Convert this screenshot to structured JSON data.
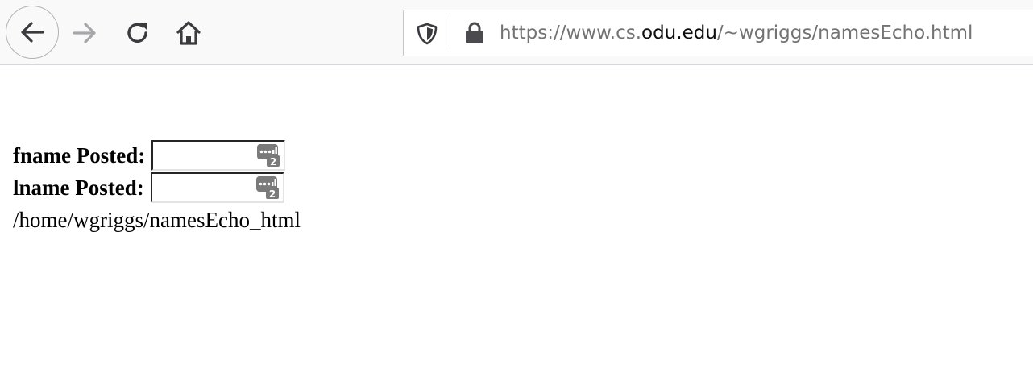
{
  "toolbar": {
    "back_icon": "arrow-left-icon",
    "forward_icon": "arrow-right-icon",
    "reload_icon": "reload-icon",
    "home_icon": "home-icon",
    "forward_disabled": true
  },
  "urlbar": {
    "shield_icon": "shield-icon",
    "lock_icon": "lock-icon",
    "url_prefix": "https://www.cs.",
    "url_domain": "odu.edu",
    "url_suffix": "/~wgriggs/namesEcho.html"
  },
  "page": {
    "fields": [
      {
        "label": "fname Posted:",
        "value": "",
        "badge_icon": "password-manager-icon",
        "badge_count": "2"
      },
      {
        "label": "lname Posted:",
        "value": "",
        "badge_icon": "password-manager-icon",
        "badge_count": "2"
      }
    ],
    "path_text": "/home/wgriggs/namesEcho_html"
  },
  "colors": {
    "toolbar_bg": "#f9f9fa",
    "icon_gray": "#4a4a4f",
    "icon_disabled": "#a0a0a3",
    "url_gray": "#737373",
    "badge_gray": "#7a7a7a"
  }
}
